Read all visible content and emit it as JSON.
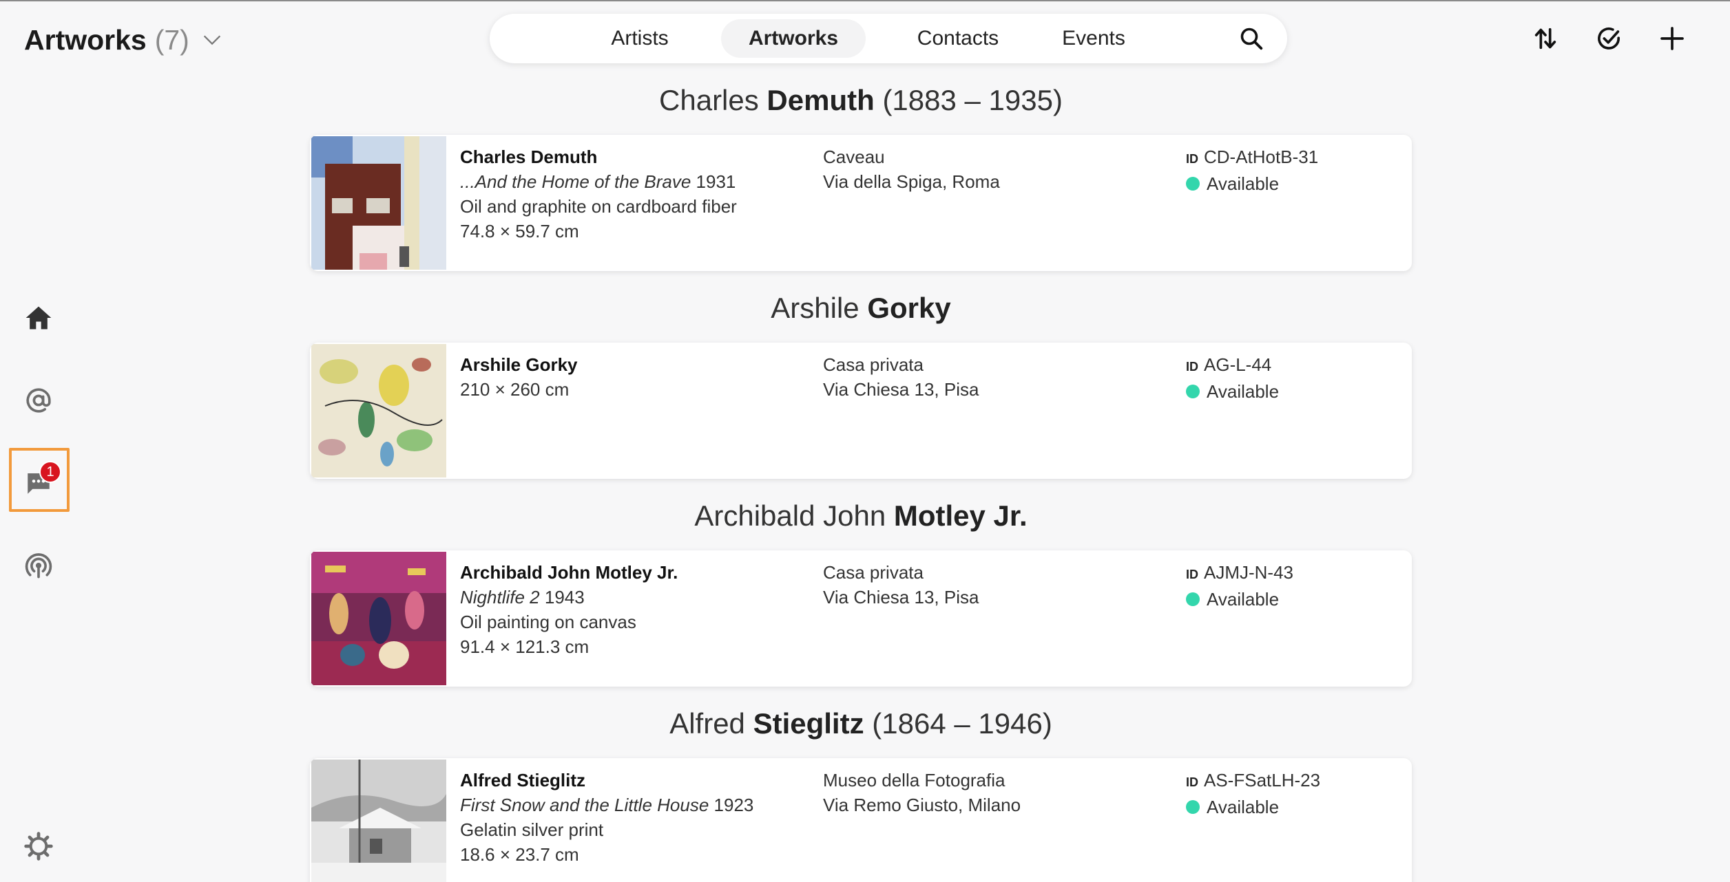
{
  "header": {
    "title": "Artworks",
    "count": "(7)",
    "tabs": [
      {
        "label": "Artists",
        "active": false
      },
      {
        "label": "Artworks",
        "active": true
      },
      {
        "label": "Contacts",
        "active": false
      },
      {
        "label": "Events",
        "active": false
      }
    ]
  },
  "sidebar": {
    "chat_badge": "1"
  },
  "colors": {
    "available": "#33d6ac",
    "badge": "#d8141f",
    "highlight": "#f29a3c"
  },
  "groups": [
    {
      "heading_first": "Charles",
      "heading_last": "Demuth",
      "heading_dates": "(1883 – 1935)",
      "artwork": {
        "artist": "Charles Demuth",
        "title": "...And the Home of the Brave",
        "year": "1931",
        "medium": "Oil and graphite on cardboard fiber",
        "dimensions": "74.8 × 59.7 cm",
        "location_name": "Caveau",
        "location_address": "Via della Spiga, Roma",
        "id_label": "ID",
        "id": "CD-AtHotB-31",
        "status": "Available"
      }
    },
    {
      "heading_first": "Arshile",
      "heading_last": "Gorky",
      "heading_dates": "",
      "artwork": {
        "artist": "Arshile Gorky",
        "dimensions": "210 × 260 cm",
        "location_name": "Casa privata",
        "location_address": "Via Chiesa 13, Pisa",
        "id_label": "ID",
        "id": "AG-L-44",
        "status": "Available"
      }
    },
    {
      "heading_first": "Archibald John",
      "heading_last": "Motley Jr.",
      "heading_dates": "",
      "artwork": {
        "artist": "Archibald John Motley Jr.",
        "title": "Nightlife 2",
        "year": "1943",
        "medium": "Oil painting on canvas",
        "dimensions": "91.4 × 121.3 cm",
        "location_name": "Casa privata",
        "location_address": "Via Chiesa 13, Pisa",
        "id_label": "ID",
        "id": "AJMJ-N-43",
        "status": "Available"
      }
    },
    {
      "heading_first": "Alfred",
      "heading_last": "Stieglitz",
      "heading_dates": "(1864 – 1946)",
      "artwork": {
        "artist": "Alfred Stieglitz",
        "title": "First Snow and the Little House",
        "year": "1923",
        "medium": "Gelatin silver print",
        "dimensions": "18.6 × 23.7 cm",
        "location_name": "Museo della Fotografia",
        "location_address": "Via Remo Giusto, Milano",
        "id_label": "ID",
        "id": "AS-FSatLH-23",
        "status": "Available"
      }
    }
  ]
}
